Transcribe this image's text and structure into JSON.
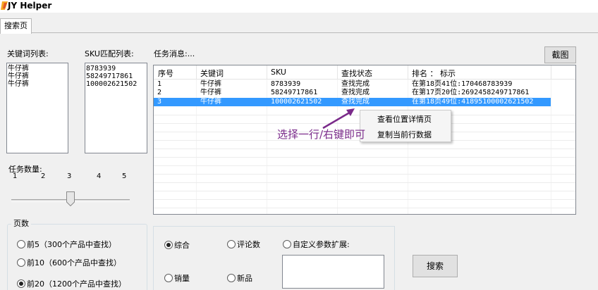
{
  "window": {
    "title": "JY Helper"
  },
  "tabs": [
    {
      "label": "搜索页"
    }
  ],
  "keyword_list": {
    "label": "关键词列表:",
    "items": [
      "牛仔裤",
      "牛仔裤",
      "牛仔裤"
    ]
  },
  "sku_list": {
    "label": "SKU匹配列表:",
    "items": [
      "8783939",
      "58249717861",
      "100002621502"
    ]
  },
  "task_count": {
    "label": "任务数量:",
    "ticks": [
      "1",
      "2",
      "3",
      "4",
      "5"
    ],
    "value": 3
  },
  "pages": {
    "group_title": "页数",
    "options": [
      {
        "label": "前5（300个产品中查找）",
        "checked": false
      },
      {
        "label": "前10（600个产品中查找）",
        "checked": false
      },
      {
        "label": "前20（1200个产品中查找）",
        "checked": true
      }
    ]
  },
  "task_messages": {
    "label": "任务消息:..."
  },
  "screenshot_button": {
    "label": "截图"
  },
  "task_grid": {
    "columns": [
      "序号",
      "关键词",
      "SKU",
      "查找状态",
      "排名 ： 标示"
    ],
    "rows": [
      {
        "no": "1",
        "keyword": "牛仔裤",
        "sku": "8783939",
        "status": "查找完成",
        "rank": "在第18页41位:170468783939",
        "selected": false
      },
      {
        "no": "2",
        "keyword": "牛仔裤",
        "sku": "58249717861",
        "status": "查找完成",
        "rank": "在第17页20位:2692458249717861",
        "selected": false
      },
      {
        "no": "3",
        "keyword": "牛仔裤",
        "sku": "100002621502",
        "status": "查找完成",
        "rank": "在第18页49位:41895100002621502",
        "selected": true
      }
    ]
  },
  "context_menu": {
    "items": [
      "查看位置详情页",
      "复制当前行数据"
    ]
  },
  "annotation": {
    "text": "选择一行/右键即可"
  },
  "sort_options": {
    "items": [
      {
        "label": "综合",
        "checked": true
      },
      {
        "label": "评论数",
        "checked": false
      },
      {
        "label": "自定义参数扩展:",
        "checked": false
      },
      {
        "label": "销量",
        "checked": false
      },
      {
        "label": "新品",
        "checked": false
      }
    ]
  },
  "search_button": {
    "label": "搜索"
  },
  "colors": {
    "selection": "#3399ff",
    "annotation": "#7a2a8a",
    "arrow": "#7a2a8a"
  }
}
